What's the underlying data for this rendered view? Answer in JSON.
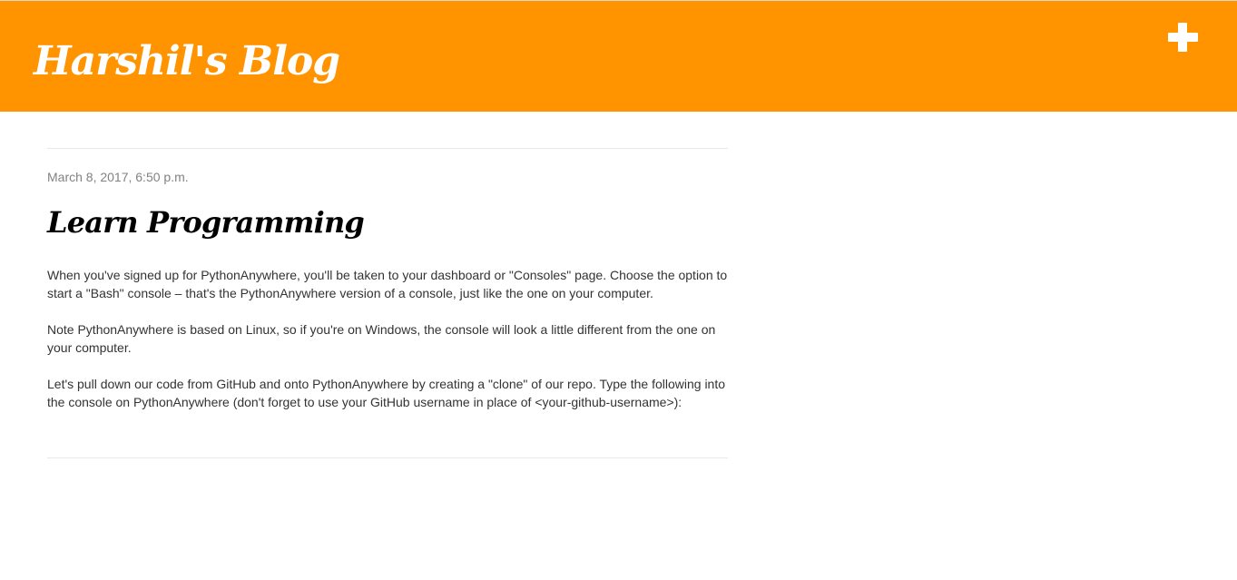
{
  "header": {
    "blog_title": "Harshil's Blog",
    "add_icon": "plus-icon",
    "background_color": "#ff9400"
  },
  "post": {
    "date": "March 8, 2017, 6:50 p.m.",
    "title": "Learn Programming",
    "paragraphs": [
      "When you've signed up for PythonAnywhere, you'll be taken to your dashboard or \"Consoles\" page. Choose the option to start a \"Bash\" console – that's the PythonAnywhere version of a console, just like the one on your computer.",
      "Note PythonAnywhere is based on Linux, so if you're on Windows, the console will look a little different from the one on your computer.",
      "Let's pull down our code from GitHub and onto PythonAnywhere by creating a \"clone\" of our repo. Type the following into the console on PythonAnywhere (don't forget to use your GitHub username in place of <your-github-username>):"
    ]
  }
}
